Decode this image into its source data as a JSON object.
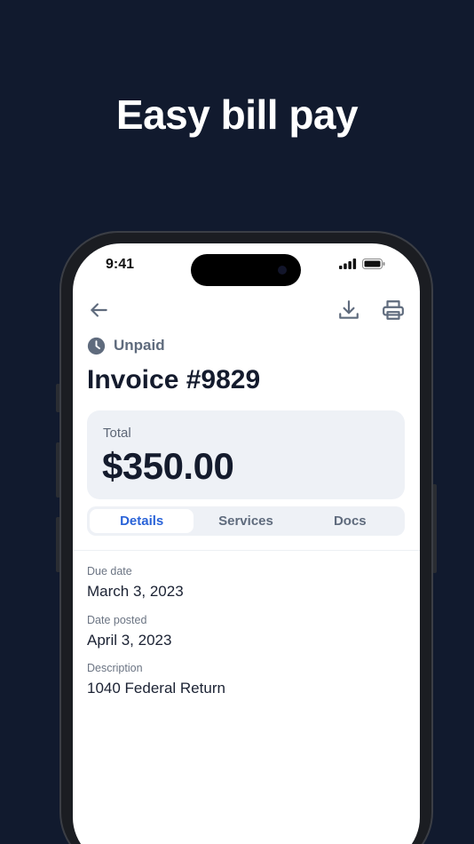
{
  "headline": "Easy bill pay",
  "status_bar": {
    "time": "9:41"
  },
  "invoice": {
    "status": "Unpaid",
    "title": "Invoice #9829",
    "total_label": "Total",
    "total_value": "$350.00"
  },
  "tabs": [
    {
      "label": "Details",
      "active": true
    },
    {
      "label": "Services",
      "active": false
    },
    {
      "label": "Docs",
      "active": false
    }
  ],
  "details": {
    "due_date_label": "Due date",
    "due_date_value": "March 3, 2023",
    "date_posted_label": "Date posted",
    "date_posted_value": "April 3, 2023",
    "description_label": "Description",
    "description_value": "1040 Federal Return"
  },
  "icons": {
    "back": "arrow-left-icon",
    "download": "download-icon",
    "print": "printer-icon",
    "status": "clock-icon"
  },
  "colors": {
    "background": "#111a2e",
    "active_tab": "#2a63d8",
    "card": "#eef1f6"
  }
}
